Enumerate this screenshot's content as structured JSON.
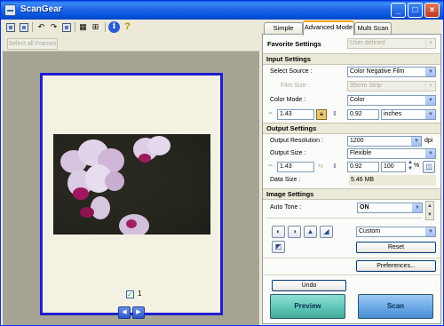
{
  "window": {
    "title": "ScanGear"
  },
  "toolbar": {
    "tools": [
      "multi-crop-icon",
      "frame-icon",
      "rotate-left-icon",
      "rotate-right-icon",
      "thumbnail-icon",
      "whole-image-icon",
      "info-icon",
      "help-icon"
    ],
    "info_glyph": "i",
    "help_glyph": "?"
  },
  "left": {
    "select_all_frames": "Select all Frames",
    "frame_number": "1"
  },
  "tabs": [
    {
      "label": "Simple Mode",
      "active": false
    },
    {
      "label": "Advanced Mode",
      "active": true
    },
    {
      "label": "Multi Scan",
      "active": false
    }
  ],
  "favorite": {
    "label": "Favorite Settings",
    "value": "User defined"
  },
  "input_settings": {
    "heading": "Input Settings",
    "select_source_label": "Select Source :",
    "select_source_value": "Color Negative Film",
    "film_size_label": "Film Size :",
    "film_size_value": "35mm Strip",
    "color_mode_label": "Color Mode :",
    "color_mode_value": "Color",
    "width": "1.43",
    "height": "0.92",
    "unit": "inches"
  },
  "output_settings": {
    "heading": "Output Settings",
    "resolution_label": "Output Resolution :",
    "resolution_value": "1200",
    "resolution_unit": "dpi",
    "size_label": "Output Size :",
    "size_value": "Flexible",
    "width": "1.43",
    "height": "0.92",
    "scale": "100",
    "scale_unit": "%",
    "data_size_label": "Data Size :",
    "data_size_value": "5.46 MB"
  },
  "image_settings": {
    "heading": "Image Settings",
    "auto_tone_label": "Auto Tone :",
    "auto_tone_value": "ON",
    "tone_preset": "Custom",
    "reset_label": "Reset",
    "preferences_label": "Preferences..."
  },
  "actions": {
    "undo_label": "Undo",
    "preview_label": "Preview",
    "scan_label": "Scan"
  },
  "colors": {
    "title_bar": "#0a5be8",
    "frame_border": "#1f1fcf",
    "preview_button": "#5fc7b8",
    "scan_button": "#6ba9e6"
  }
}
